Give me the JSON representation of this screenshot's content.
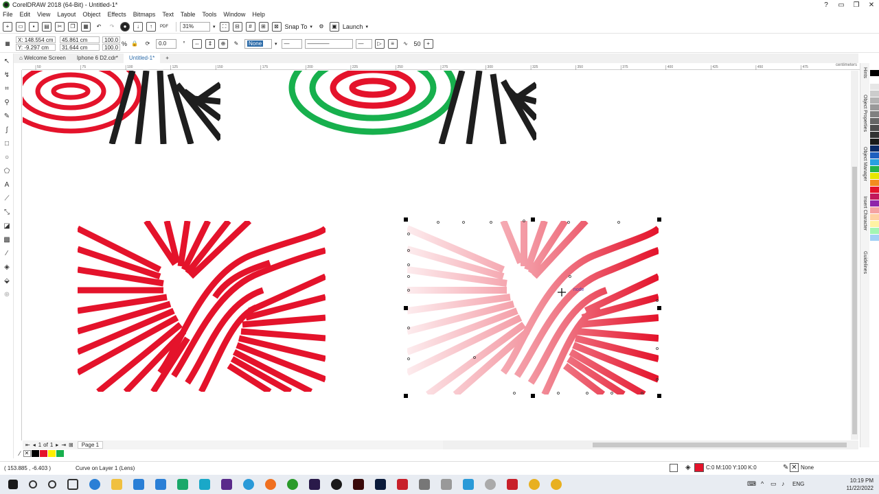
{
  "window": {
    "title": "CorelDRAW 2018 (64-Bit) - Untitled-1*",
    "buttons": [
      "?",
      "▭",
      "❐",
      "✕"
    ]
  },
  "menu": [
    "File",
    "Edit",
    "View",
    "Layout",
    "Object",
    "Effects",
    "Bitmaps",
    "Text",
    "Table",
    "Tools",
    "Window",
    "Help"
  ],
  "std_toolbar": {
    "zoom": "31%",
    "snap_label": "Snap To",
    "launch_label": "Launch"
  },
  "prop_bar": {
    "x": "X: 148.554 cm",
    "y": "Y: -9.297 cm",
    "w": "45.861 cm",
    "h": "31.644 cm",
    "sx": "100.0",
    "sy": "100.0",
    "pct": "%",
    "angle": "0.0",
    "outline": "None",
    "smooth": "50"
  },
  "tabs": [
    "Welcome Screen",
    "Iphone 6 D2.cdr*",
    "Untitled-1*"
  ],
  "ruler": {
    "unit": "centimeters",
    "ticks": [
      "50",
      "75",
      "100",
      "125",
      "150",
      "175",
      "200",
      "225",
      "250",
      "275",
      "300",
      "325",
      "350",
      "375",
      "400",
      "425",
      "450",
      "475"
    ]
  },
  "dockers": [
    "Hints",
    "Object Properties",
    "Object Manager",
    "Insert Character",
    "Guidelines"
  ],
  "canvas": {
    "node_label": "node"
  },
  "page_nav": {
    "current": "1",
    "of": "of",
    "total": "1",
    "page_tab": "Page 1"
  },
  "status": {
    "coords": "( 153.885 , -6.403 )",
    "info": "Curve on Layer 1 (Lens)",
    "fill": "C:0 M:100 Y:100 K:0",
    "outline": "None"
  },
  "taskbar": {
    "lang": "ENG",
    "time": "10:19 PM",
    "date": "11/22/2022"
  },
  "colors": {
    "red": "#e4132b",
    "green": "#17b04d",
    "black": "#1e1e1e",
    "accent": "#2a6aa8"
  },
  "palette": [
    "#ffffff",
    "#000000",
    "#ffffff",
    "#e6e6e6",
    "#cccccc",
    "#b3b3b3",
    "#999999",
    "#808080",
    "#666666",
    "#4d4d4d",
    "#333333",
    "#1a1a1a",
    "#0a2a66",
    "#1f5fbf",
    "#2aa0e0",
    "#27b34a",
    "#e6e600",
    "#f28c1f",
    "#e4132b",
    "#c2185b",
    "#8e24aa",
    "#f5a3a3",
    "#ffd1a3",
    "#fff2a3",
    "#a3f5b3",
    "#a3d1f5"
  ],
  "doc_palette": [
    "#000000",
    "#e4132b",
    "#ffef00",
    "#17b04d"
  ]
}
